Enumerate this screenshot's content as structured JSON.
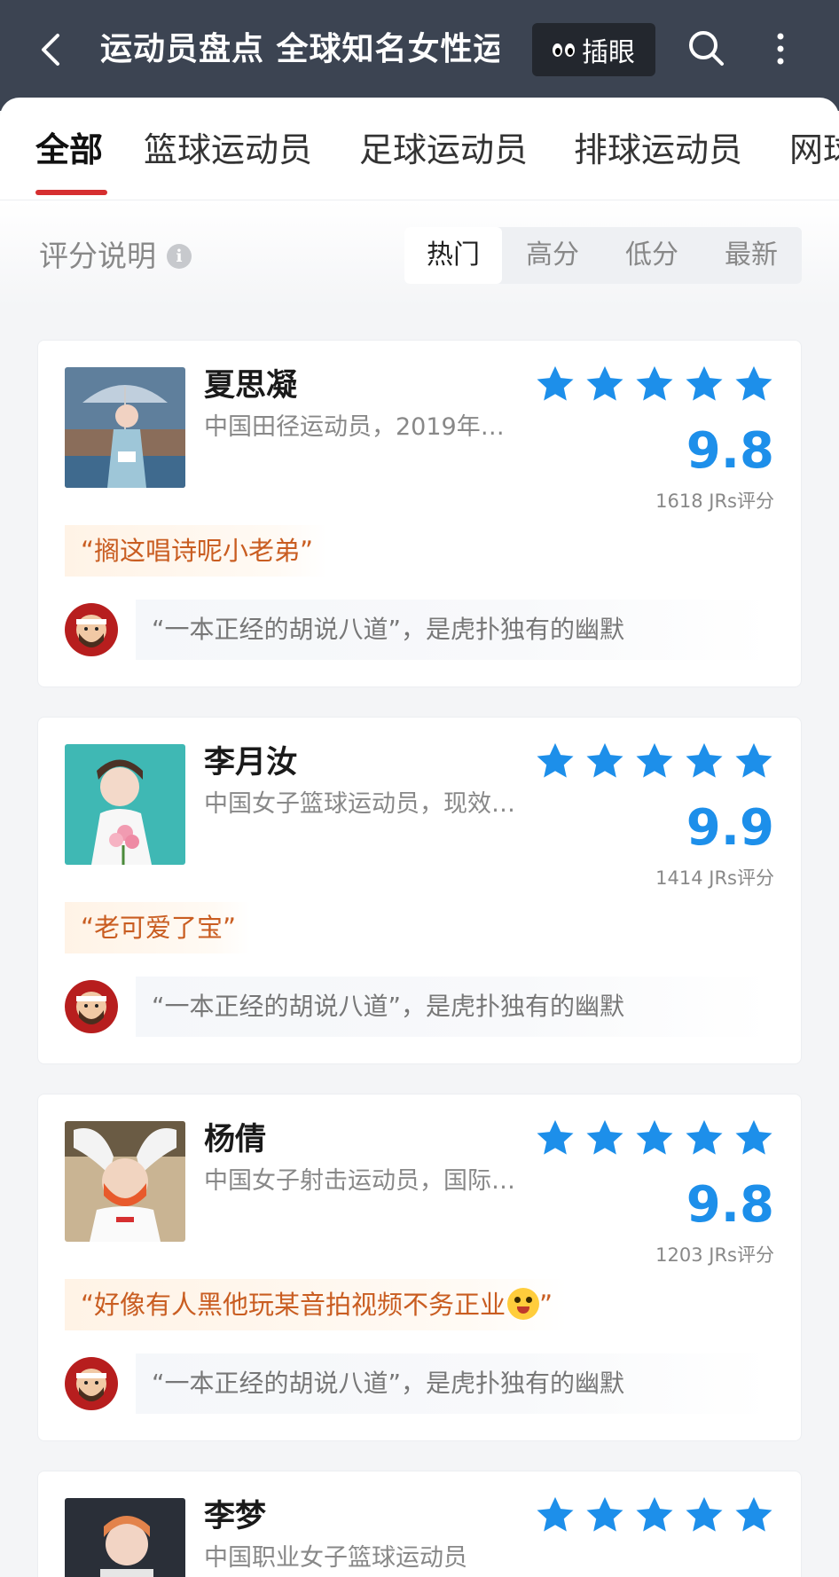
{
  "header": {
    "title": "运动员盘点 全球知名女性运",
    "eye_button_label": "插眼"
  },
  "tabs": [
    {
      "label": "全部",
      "active": true
    },
    {
      "label": "篮球运动员",
      "active": false
    },
    {
      "label": "足球运动员",
      "active": false
    },
    {
      "label": "排球运动员",
      "active": false
    },
    {
      "label": "网球",
      "active": false
    }
  ],
  "sort": {
    "explain_label": "评分说明",
    "options": [
      "热门",
      "高分",
      "低分",
      "最新"
    ],
    "active": "热门"
  },
  "colors": {
    "header_bg": "#3c4452",
    "accent_red": "#d62f30",
    "star_blue": "#1d8fea",
    "quote_orange": "#c95d21"
  },
  "cards": [
    {
      "name": "夏思凝",
      "desc": "中国田径运动员，2019年…",
      "stars": 5,
      "score": "9.8",
      "count": "1618 JRs评分",
      "quote": "“搁这唱诗呢小老弟”",
      "comment": "“一本正经的胡说八道”，是虎扑独有的幽默"
    },
    {
      "name": "李月汝",
      "desc": "中国女子篮球运动员，现效…",
      "stars": 5,
      "score": "9.9",
      "count": "1414 JRs评分",
      "quote": "“老可爱了宝”",
      "comment": "“一本正经的胡说八道”，是虎扑独有的幽默"
    },
    {
      "name": "杨倩",
      "desc": "中国女子射击运动员，国际…",
      "stars": 5,
      "score": "9.8",
      "count": "1203 JRs评分",
      "quote": "“好像有人黑他玩某音拍视频不务正业",
      "quote_end": "”",
      "comment": "“一本正经的胡说八道”，是虎扑独有的幽默"
    },
    {
      "name": "李梦",
      "desc": "中国职业女子篮球运动员",
      "stars": 5
    }
  ]
}
